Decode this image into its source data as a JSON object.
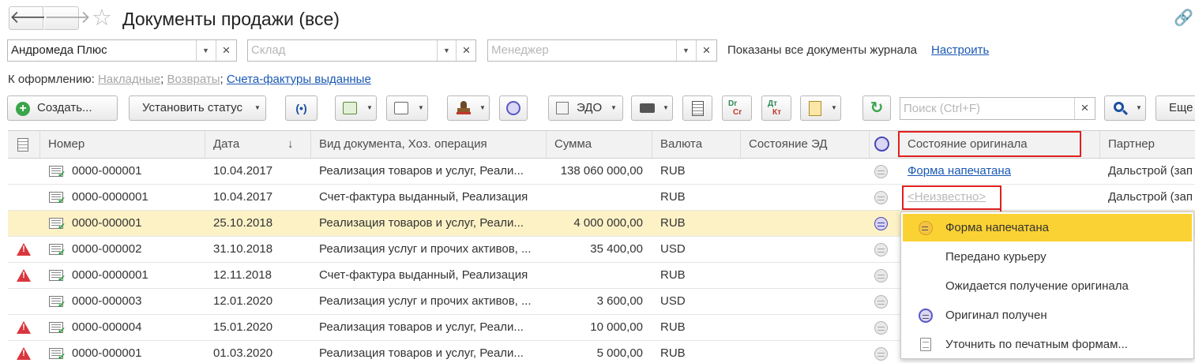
{
  "window": {
    "title": "Документы продажи (все)"
  },
  "filters": {
    "organization": {
      "value": "Андромеда Плюс"
    },
    "warehouse": {
      "placeholder": "Склад"
    },
    "manager": {
      "placeholder": "Менеджер"
    },
    "info_text": "Показаны все документы журнала",
    "configure_link": "Настроить"
  },
  "to_process": {
    "label": "К оформлению:",
    "links": [
      {
        "text": "Накладные",
        "state": "inactive"
      },
      {
        "text": "Возвраты",
        "state": "inactive"
      },
      {
        "text": "Счета-фактуры выданные",
        "state": "active"
      }
    ],
    "separators": [
      "; ",
      "; "
    ]
  },
  "toolbar": {
    "create_label": "Создать...",
    "set_status_label": "Установить статус",
    "edo_label": "ЭДО",
    "search_placeholder": "Поиск (Ctrl+F)",
    "more_label": "Еще",
    "accent_green": "#3aa54b"
  },
  "table": {
    "columns": {
      "number": "Номер",
      "date": "Дата",
      "sort_indicator": "↓",
      "doc_type": "Вид документа, Хоз. операция",
      "sum": "Сумма",
      "currency": "Валюта",
      "ed_state": "Состояние ЭД",
      "original_state": "Состояние оригинала",
      "partner": "Партнер"
    },
    "rows": [
      {
        "warning": false,
        "number": "0000-000001",
        "date": "10.04.2017",
        "doc_type": "Реализация товаров и услуг, Реали...",
        "sum": "138 060 000,00",
        "currency": "RUB",
        "original": "Форма напечатана",
        "original_style": "link",
        "partner": "Дальстрой (зап",
        "selected": false
      },
      {
        "warning": false,
        "number": "0000-0000001",
        "date": "10.04.2017",
        "doc_type": "Счет-фактура выданный, Реализация",
        "sum": "",
        "currency": "RUB",
        "original": "<Неизвестно>",
        "original_style": "unknown",
        "partner": "Дальстрой (зап",
        "selected": false
      },
      {
        "warning": false,
        "number": "0000-000001",
        "date": "25.10.2018",
        "doc_type": "Реализация товаров и услуг, Реали...",
        "sum": "4 000 000,00",
        "currency": "RUB",
        "original": "",
        "original_style": "none",
        "partner": "",
        "selected": true
      },
      {
        "warning": true,
        "number": "0000-000002",
        "date": "31.10.2018",
        "doc_type": "Реализация услуг и прочих активов, ...",
        "sum": "35 400,00",
        "currency": "USD",
        "original": "",
        "original_style": "none",
        "partner": "",
        "selected": false
      },
      {
        "warning": true,
        "number": "0000-0000001",
        "date": "12.11.2018",
        "doc_type": "Счет-фактура выданный, Реализация",
        "sum": "",
        "currency": "RUB",
        "original": "",
        "original_style": "none",
        "partner": "",
        "selected": false
      },
      {
        "warning": false,
        "number": "0000-000003",
        "date": "12.01.2020",
        "doc_type": "Реализация услуг и прочих активов, ...",
        "sum": "3 600,00",
        "currency": "USD",
        "original": "",
        "original_style": "none",
        "partner": "",
        "selected": false
      },
      {
        "warning": true,
        "number": "0000-000004",
        "date": "15.01.2020",
        "doc_type": "Реализация товаров и услуг, Реали...",
        "sum": "10 000,00",
        "currency": "RUB",
        "original": "",
        "original_style": "none",
        "partner": "",
        "selected": false
      },
      {
        "warning": true,
        "number": "0000-000001",
        "date": "01.03.2020",
        "doc_type": "Реализация товаров и услуг, Реали...",
        "sum": "5 000,00",
        "currency": "RUB",
        "original": "",
        "original_style": "none",
        "partner": "",
        "selected": false
      }
    ]
  },
  "popup": {
    "items": [
      {
        "label": "Форма напечатана",
        "icon": "yellow-original-icon",
        "highlighted": true
      },
      {
        "label": "Передано курьеру",
        "icon": "",
        "highlighted": false
      },
      {
        "label": "Ожидается получение оригинала",
        "icon": "",
        "highlighted": false
      },
      {
        "label": "Оригинал получен",
        "icon": "violet-original-icon",
        "highlighted": false
      },
      {
        "label": "Уточнить по печатным формам...",
        "icon": "document-icon",
        "highlighted": false
      }
    ]
  },
  "colors": {
    "selected_row": "#fdf2c6",
    "popup_highlight": "#fbd233",
    "link_blue": "#1a58b4",
    "annotation_red": "#e02020"
  }
}
